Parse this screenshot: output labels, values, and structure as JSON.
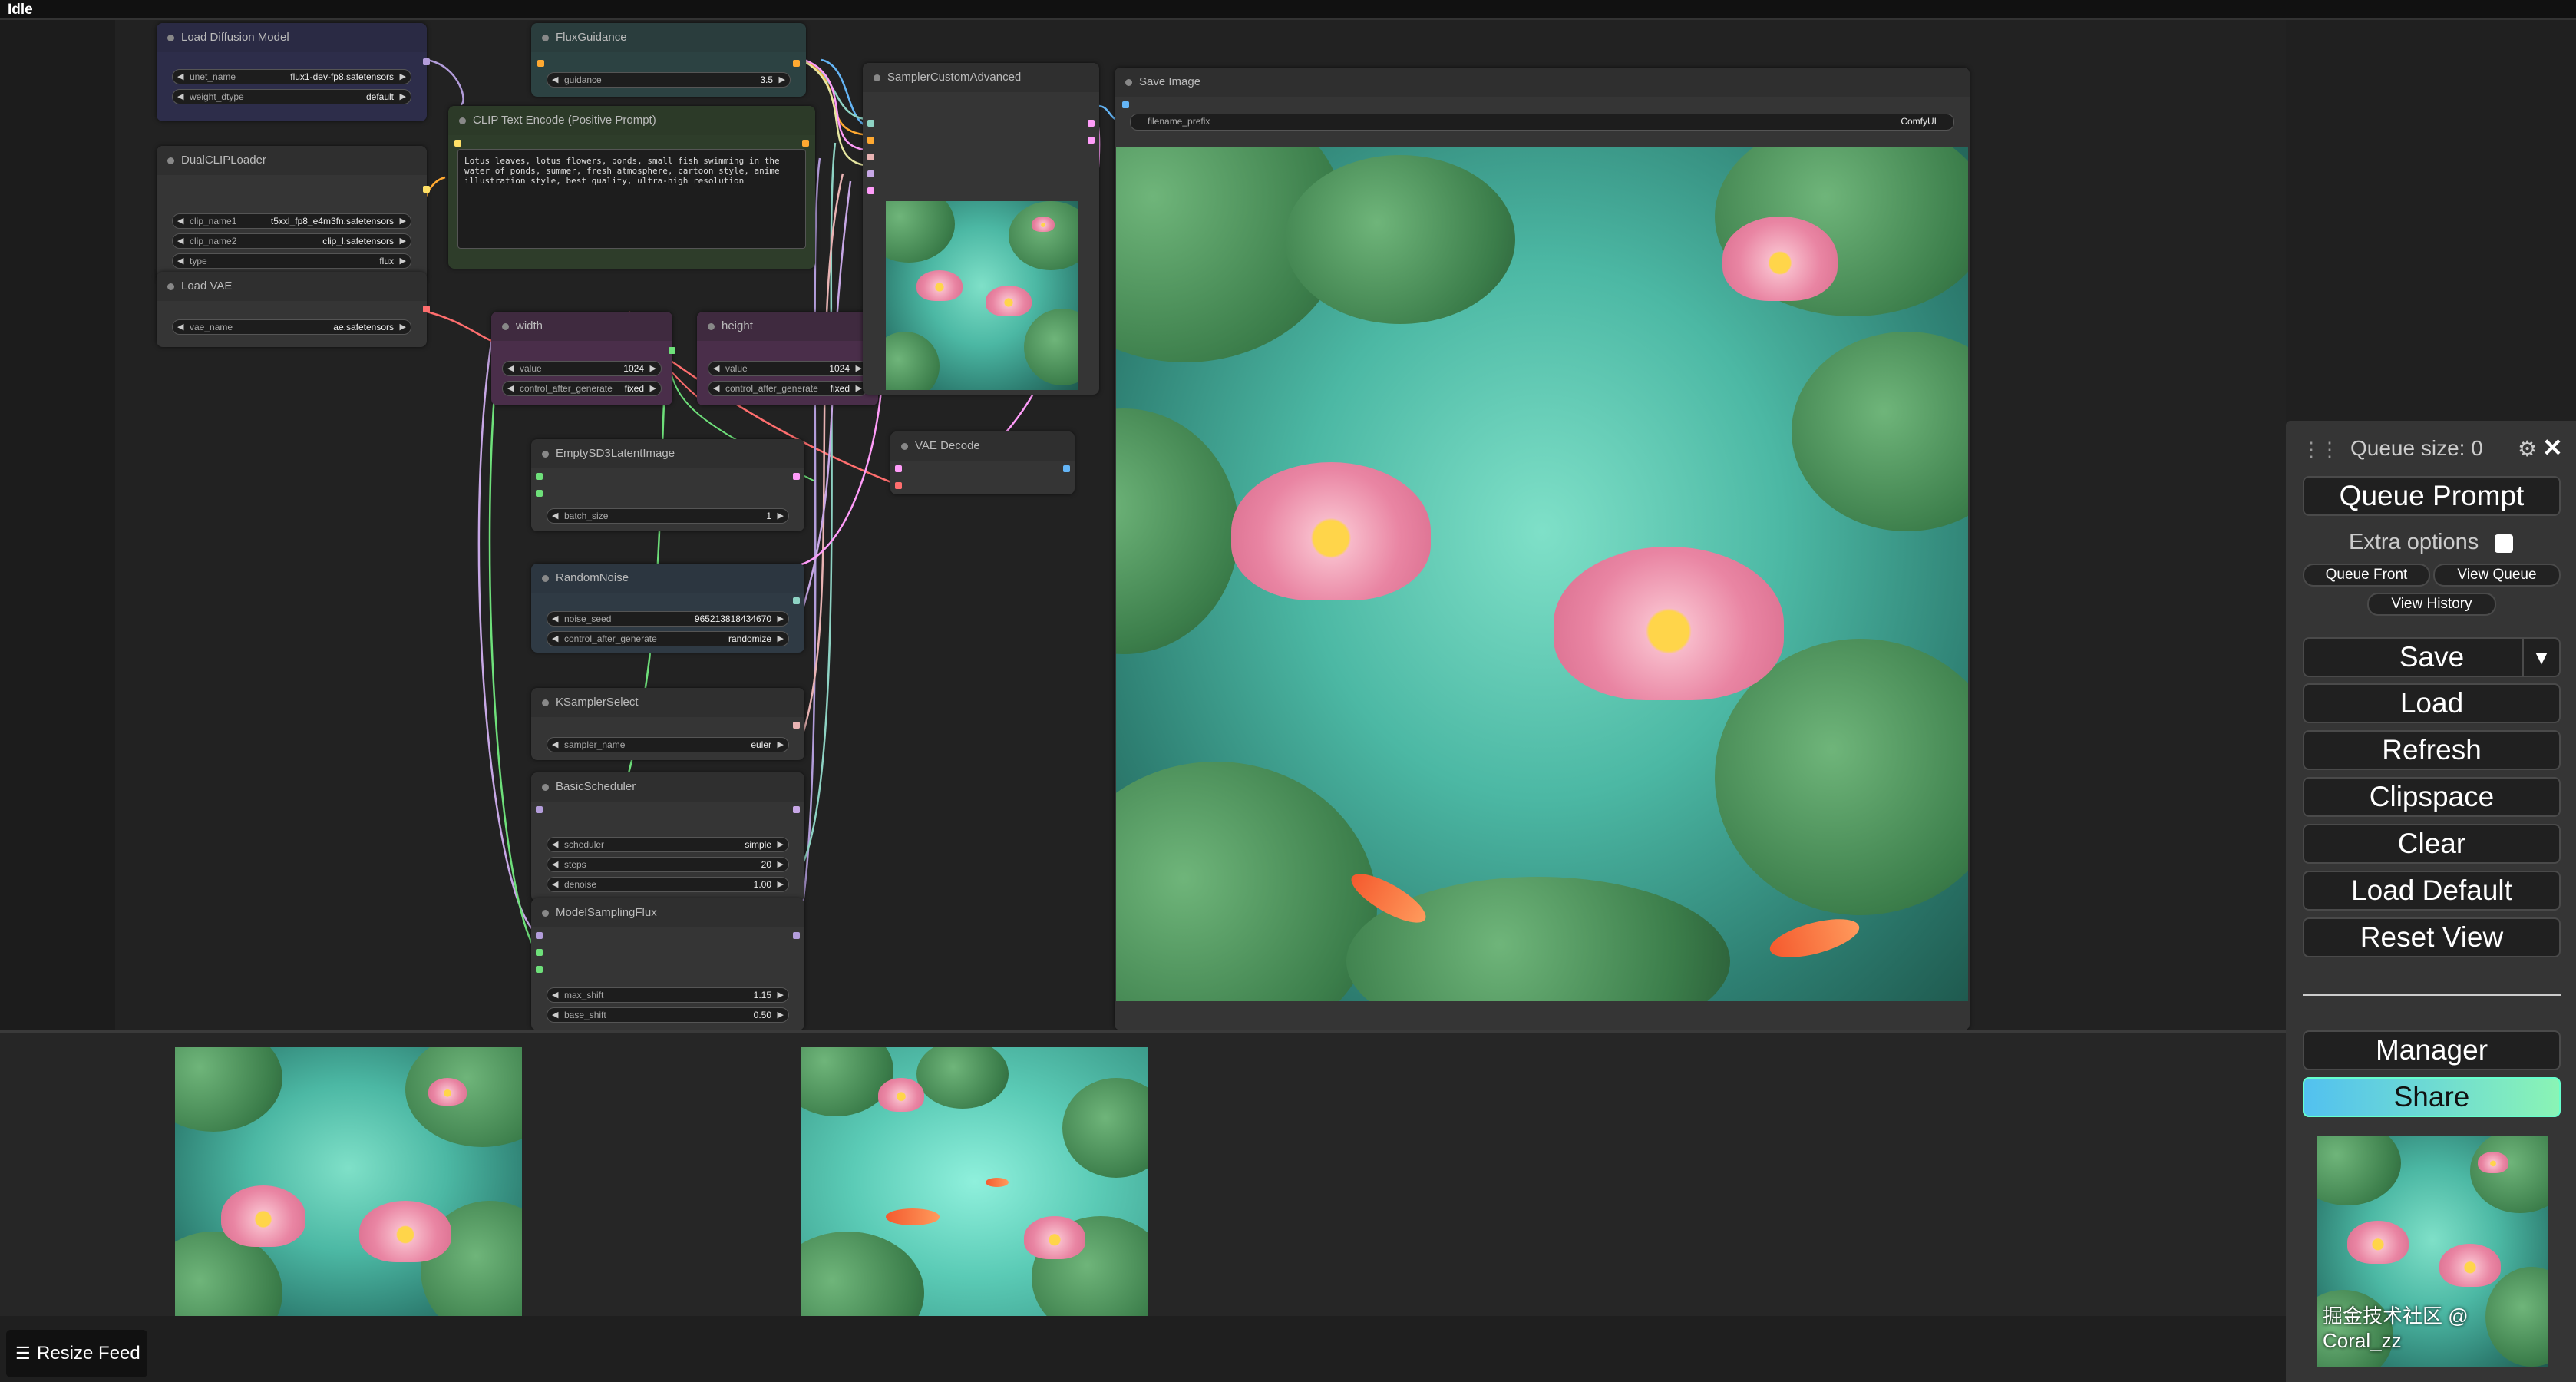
{
  "app": {
    "status": "Idle"
  },
  "nodes": {
    "load_diffusion": {
      "title": "Load Diffusion Model",
      "widgets": [
        {
          "name": "unet_name",
          "value": "flux1-dev-fp8.safetensors"
        },
        {
          "name": "weight_dtype",
          "value": "default"
        }
      ]
    },
    "flux_guidance": {
      "title": "FluxGuidance",
      "widgets": [
        {
          "name": "guidance",
          "value": "3.5"
        }
      ]
    },
    "clip_text": {
      "title": "CLIP Text Encode (Positive Prompt)",
      "text": "Lotus leaves, lotus flowers, ponds, small fish swimming in the water of ponds, summer, fresh atmosphere, cartoon style, anime illustration style, best quality, ultra-high resolution"
    },
    "dual_clip": {
      "title": "DualCLIPLoader",
      "widgets": [
        {
          "name": "clip_name1",
          "value": "t5xxl_fp8_e4m3fn.safetensors"
        },
        {
          "name": "clip_name2",
          "value": "clip_l.safetensors"
        },
        {
          "name": "type",
          "value": "flux"
        }
      ]
    },
    "load_vae": {
      "title": "Load VAE",
      "widgets": [
        {
          "name": "vae_name",
          "value": "ae.safetensors"
        }
      ]
    },
    "width": {
      "title": "width",
      "widgets": [
        {
          "name": "value",
          "value": "1024"
        },
        {
          "name": "control_after_generate",
          "value": "fixed"
        }
      ]
    },
    "height": {
      "title": "height",
      "widgets": [
        {
          "name": "value",
          "value": "1024"
        },
        {
          "name": "control_after_generate",
          "value": "fixed"
        }
      ]
    },
    "sampler_advanced": {
      "title": "SamplerCustomAdvanced"
    },
    "vae_decode": {
      "title": "VAE Decode"
    },
    "save_image": {
      "title": "Save Image",
      "widgets": [
        {
          "name": "filename_prefix",
          "value": "ComfyUI"
        }
      ]
    },
    "empty_latent": {
      "title": "EmptySD3LatentImage",
      "widgets": [
        {
          "name": "batch_size",
          "value": "1"
        }
      ]
    },
    "random_noise": {
      "title": "RandomNoise",
      "widgets": [
        {
          "name": "noise_seed",
          "value": "965213818434670"
        },
        {
          "name": "control_after_generate",
          "value": "randomize"
        }
      ]
    },
    "ksampler_select": {
      "title": "KSamplerSelect",
      "widgets": [
        {
          "name": "sampler_name",
          "value": "euler"
        }
      ]
    },
    "basic_scheduler": {
      "title": "BasicScheduler",
      "widgets": [
        {
          "name": "scheduler",
          "value": "simple"
        },
        {
          "name": "steps",
          "value": "20"
        },
        {
          "name": "denoise",
          "value": "1.00"
        }
      ]
    },
    "model_sampling": {
      "title": "ModelSamplingFlux",
      "widgets": [
        {
          "name": "max_shift",
          "value": "1.15"
        },
        {
          "name": "base_shift",
          "value": "0.50"
        }
      ]
    }
  },
  "feed": {
    "resize_label": "Resize Feed",
    "resize_icon": "sliders-icon"
  },
  "menu": {
    "queue_size": "Queue size: 0",
    "queue_prompt": "Queue Prompt",
    "extra_options": "Extra options",
    "queue_front": "Queue Front",
    "view_queue": "View Queue",
    "view_history": "View History",
    "save": "Save",
    "save_arrow": "▼",
    "load": "Load",
    "refresh": "Refresh",
    "clipspace": "Clipspace",
    "clear": "Clear",
    "load_default": "Load Default",
    "reset_view": "Reset View",
    "manager": "Manager",
    "share": "Share",
    "gear_glyph": "⚙",
    "close_glyph": "✕",
    "drag_glyph": "⋮⋮",
    "watermark": "掘金技术社区 @ Coral_zz"
  },
  "colors": {
    "share_gradient_start": "#52c1f0",
    "share_gradient_end": "#8af4b5",
    "link_model": "#b39ddb",
    "link_conditioning": "#ffa931",
    "link_latent": "#ff9cf9",
    "link_vae": "#ff6e6e",
    "link_image": "#64b5f6",
    "link_int": "#6ee07a"
  }
}
